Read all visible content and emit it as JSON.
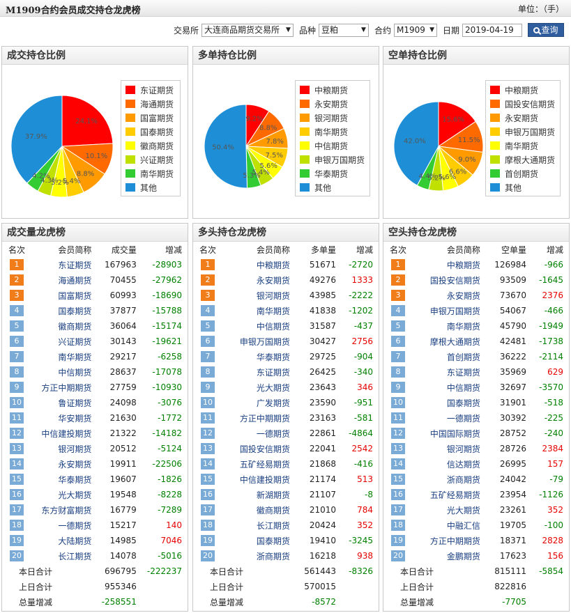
{
  "header": {
    "title": "M1909合约会员成交持仓龙虎榜",
    "unit_label": "单位：（手）"
  },
  "filters": {
    "exchange_label": "交易所",
    "exchange_value": "大连商品期货交易所",
    "variety_label": "品种",
    "variety_value": "豆粕",
    "contract_label": "合约",
    "contract_value": "M1909",
    "date_label": "日期",
    "date_value": "2019-04-19",
    "query_label": "查询"
  },
  "colors": [
    "#ff0000",
    "#ff6a00",
    "#ff9a00",
    "#ffcc00",
    "#ffff00",
    "#c0e000",
    "#33cc33",
    "#1e8fd6"
  ],
  "pies": [
    {
      "title": "成交持仓比例",
      "legend": [
        "东证期货",
        "海通期货",
        "国富期货",
        "国泰期货",
        "徽商期货",
        "兴证期货",
        "南华期货",
        "其他"
      ],
      "values": [
        24.1,
        10.1,
        8.8,
        5.4,
        5.2,
        4.3,
        4.2,
        37.9
      ],
      "labels": [
        "24.1%",
        "10.1%",
        "8.8%",
        "5.4%",
        "5.2%",
        "4.3%",
        "4.2%",
        "37.9%"
      ]
    },
    {
      "title": "多单持仓比例",
      "legend": [
        "中粮期货",
        "永安期货",
        "银河期货",
        "南华期货",
        "中信期货",
        "申银万国期货",
        "华泰期货",
        "其他"
      ],
      "values": [
        9.2,
        8.8,
        7.8,
        7.5,
        5.6,
        5.4,
        5.3,
        50.4
      ],
      "labels": [
        "9.2%",
        "8.8%",
        "7.8%",
        "7.5%",
        "5.6%",
        "5.4%",
        "5.3%",
        "50.4%"
      ]
    },
    {
      "title": "空单持仓比例",
      "legend": [
        "中粮期货",
        "国投安信期货",
        "永安期货",
        "申银万国期货",
        "南华期货",
        "摩根大通期货",
        "首创期货",
        "其他"
      ],
      "values": [
        15.6,
        11.5,
        9.0,
        6.6,
        5.6,
        5.2,
        4.4,
        42.0
      ],
      "labels": [
        "15.6%",
        "11.5%",
        "9.0%",
        "6.6%",
        "5.6%",
        "5.2%",
        "4.4%",
        "42.0%"
      ]
    }
  ],
  "tables": [
    {
      "title": "成交量龙虎榜",
      "headers": [
        "名次",
        "会员简称",
        "成交量",
        "增减"
      ],
      "rows": [
        [
          "1",
          "东证期货",
          "167963",
          "-28903"
        ],
        [
          "2",
          "海通期货",
          "70455",
          "-27962"
        ],
        [
          "3",
          "国富期货",
          "60993",
          "-18690"
        ],
        [
          "4",
          "国泰期货",
          "37877",
          "-15788"
        ],
        [
          "5",
          "徽商期货",
          "36064",
          "-15174"
        ],
        [
          "6",
          "兴证期货",
          "30143",
          "-19621"
        ],
        [
          "7",
          "南华期货",
          "29217",
          "-6258"
        ],
        [
          "8",
          "中信期货",
          "28637",
          "-17078"
        ],
        [
          "9",
          "方正中期期货",
          "27759",
          "-10930"
        ],
        [
          "10",
          "鲁证期货",
          "24098",
          "-3076"
        ],
        [
          "11",
          "华安期货",
          "21630",
          "-1772"
        ],
        [
          "12",
          "中信建投期货",
          "21322",
          "-14182"
        ],
        [
          "13",
          "银河期货",
          "20512",
          "-5124"
        ],
        [
          "14",
          "永安期货",
          "19911",
          "-22506"
        ],
        [
          "15",
          "华泰期货",
          "19607",
          "-1826"
        ],
        [
          "16",
          "光大期货",
          "19548",
          "-8228"
        ],
        [
          "17",
          "东方财富期货",
          "16779",
          "-7289"
        ],
        [
          "18",
          "一德期货",
          "15217",
          "140"
        ],
        [
          "19",
          "大陆期货",
          "14985",
          "7046"
        ],
        [
          "20",
          "长江期货",
          "14078",
          "-5016"
        ]
      ],
      "summary": [
        {
          "label": "本日合计",
          "value": "696795",
          "change": "-222237"
        },
        {
          "label": "上日合计",
          "value": "955346",
          "change": ""
        },
        {
          "label": "总量增减",
          "value": "-258551",
          "change": ""
        }
      ]
    },
    {
      "title": "多头持仓龙虎榜",
      "headers": [
        "名次",
        "会员简称",
        "多单量",
        "增减"
      ],
      "rows": [
        [
          "1",
          "中粮期货",
          "51671",
          "-2720"
        ],
        [
          "2",
          "永安期货",
          "49276",
          "1333"
        ],
        [
          "3",
          "银河期货",
          "43985",
          "-2222"
        ],
        [
          "4",
          "南华期货",
          "41838",
          "-1202"
        ],
        [
          "5",
          "中信期货",
          "31587",
          "-437"
        ],
        [
          "6",
          "申银万国期货",
          "30427",
          "2756"
        ],
        [
          "7",
          "华泰期货",
          "29725",
          "-904"
        ],
        [
          "8",
          "东证期货",
          "26425",
          "-340"
        ],
        [
          "9",
          "光大期货",
          "23643",
          "346"
        ],
        [
          "10",
          "广发期货",
          "23590",
          "-951"
        ],
        [
          "11",
          "方正中期期货",
          "23163",
          "-581"
        ],
        [
          "12",
          "一德期货",
          "22861",
          "-4864"
        ],
        [
          "13",
          "国投安信期货",
          "22041",
          "2542"
        ],
        [
          "14",
          "五矿经易期货",
          "21868",
          "-416"
        ],
        [
          "15",
          "中信建投期货",
          "21174",
          "513"
        ],
        [
          "16",
          "新湖期货",
          "21107",
          "-8"
        ],
        [
          "17",
          "徽商期货",
          "21010",
          "784"
        ],
        [
          "18",
          "长江期货",
          "20424",
          "352"
        ],
        [
          "19",
          "国泰期货",
          "19410",
          "-3245"
        ],
        [
          "20",
          "浙商期货",
          "16218",
          "938"
        ]
      ],
      "summary": [
        {
          "label": "本日合计",
          "value": "561443",
          "change": "-8326"
        },
        {
          "label": "上日合计",
          "value": "570015",
          "change": ""
        },
        {
          "label": "总量增减",
          "value": "-8572",
          "change": ""
        }
      ]
    },
    {
      "title": "空头持仓龙虎榜",
      "headers": [
        "名次",
        "会员简称",
        "空单量",
        "增减"
      ],
      "rows": [
        [
          "1",
          "中粮期货",
          "126984",
          "-966"
        ],
        [
          "2",
          "国投安信期货",
          "93509",
          "-1645"
        ],
        [
          "3",
          "永安期货",
          "73670",
          "2376"
        ],
        [
          "4",
          "申银万国期货",
          "54067",
          "-466"
        ],
        [
          "5",
          "南华期货",
          "45790",
          "-1949"
        ],
        [
          "6",
          "摩根大通期货",
          "42481",
          "-1738"
        ],
        [
          "7",
          "首创期货",
          "36222",
          "-2114"
        ],
        [
          "8",
          "东证期货",
          "35969",
          "629"
        ],
        [
          "9",
          "中信期货",
          "32697",
          "-3570"
        ],
        [
          "10",
          "国泰期货",
          "31901",
          "-518"
        ],
        [
          "11",
          "一德期货",
          "30392",
          "-225"
        ],
        [
          "12",
          "中国国际期货",
          "28752",
          "-240"
        ],
        [
          "13",
          "银河期货",
          "28726",
          "2384"
        ],
        [
          "14",
          "信达期货",
          "26995",
          "157"
        ],
        [
          "15",
          "浙商期货",
          "24042",
          "-79"
        ],
        [
          "16",
          "五矿经易期货",
          "23954",
          "-1126"
        ],
        [
          "17",
          "光大期货",
          "23261",
          "352"
        ],
        [
          "18",
          "中融汇信",
          "19705",
          "-100"
        ],
        [
          "19",
          "方正中期期货",
          "18371",
          "2828"
        ],
        [
          "20",
          "金鹏期货",
          "17623",
          "156"
        ]
      ],
      "summary": [
        {
          "label": "本日合计",
          "value": "815111",
          "change": "-5854"
        },
        {
          "label": "上日合计",
          "value": "822816",
          "change": ""
        },
        {
          "label": "总量增减",
          "value": "-7705",
          "change": ""
        }
      ]
    }
  ]
}
